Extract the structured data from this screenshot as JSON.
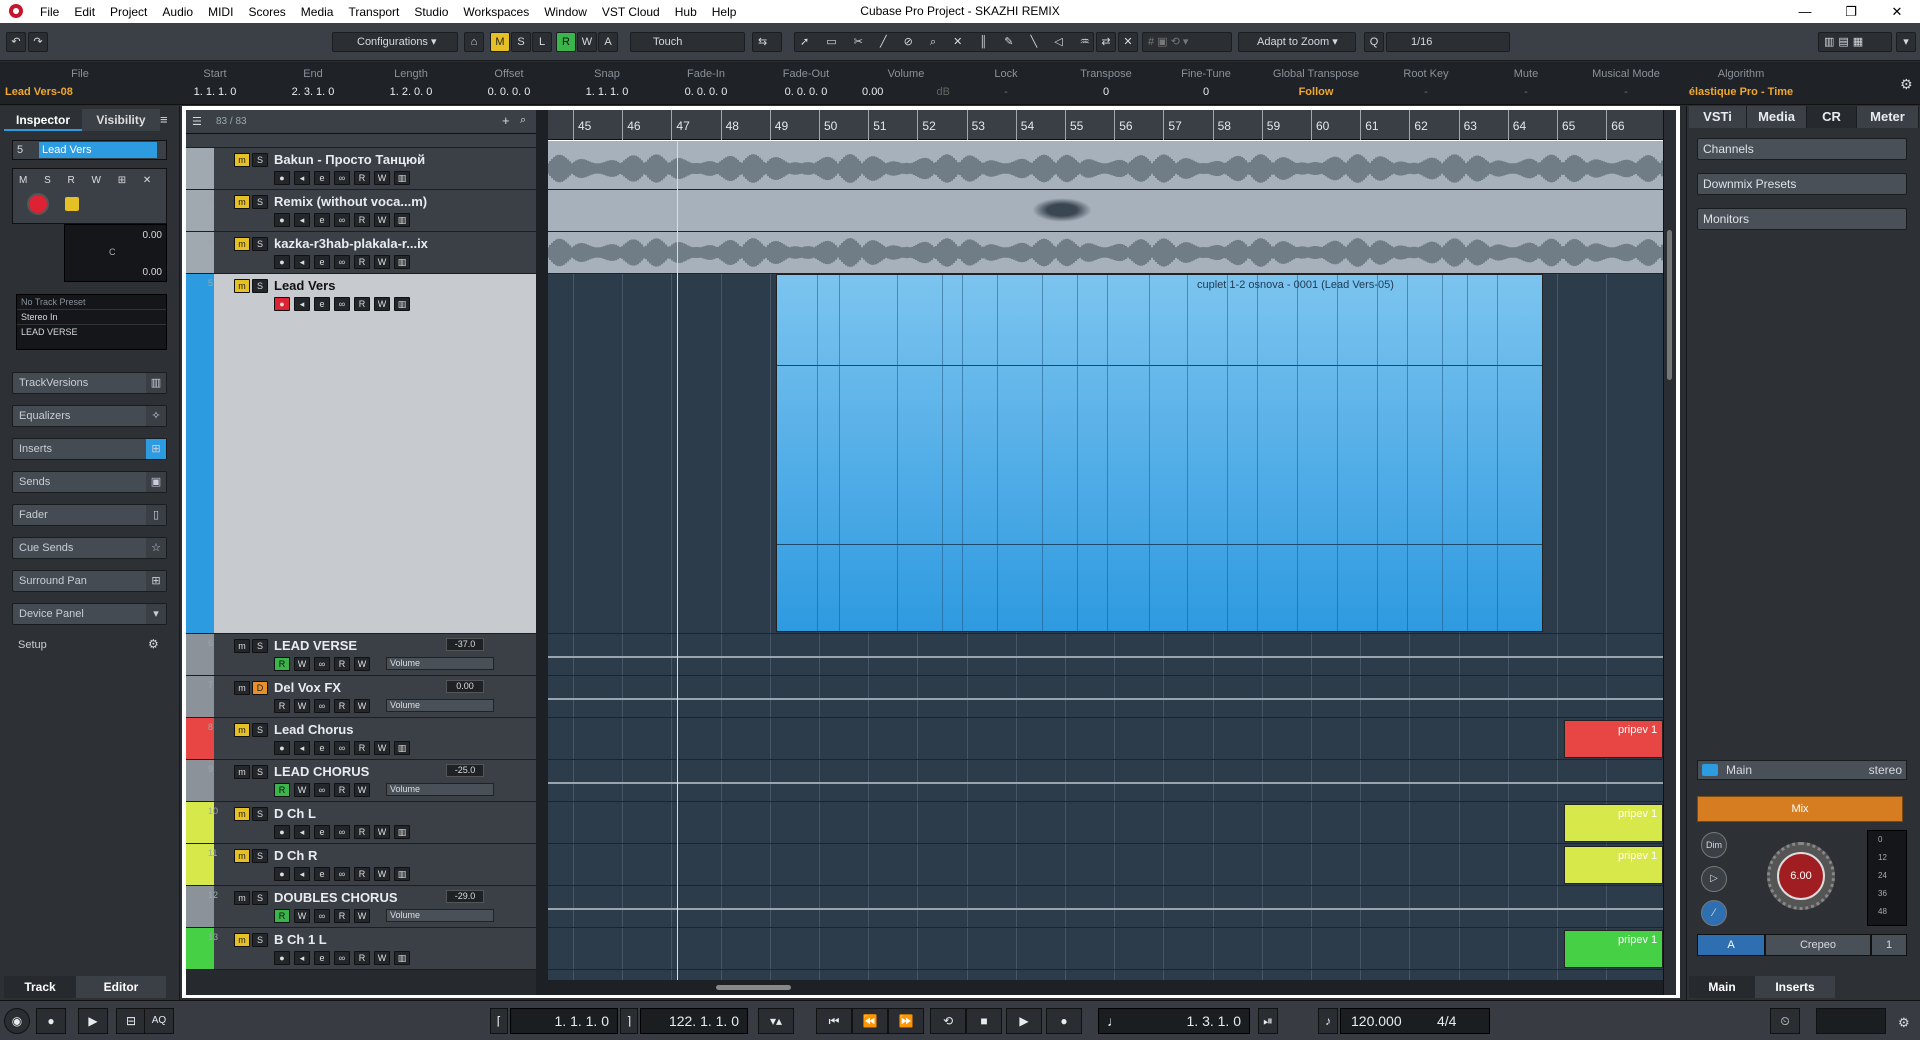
{
  "titlebar": {
    "title": "Cubase Pro Project - SKAZHI REMIX",
    "menu": [
      "File",
      "Edit",
      "Project",
      "Audio",
      "MIDI",
      "Scores",
      "Media",
      "Transport",
      "Studio",
      "Workspaces",
      "Window",
      "VST Cloud",
      "Hub",
      "Help"
    ],
    "minimize": "—",
    "restore": "❐",
    "close": "✕"
  },
  "toolbar": {
    "configurations": "Configurations",
    "m": "M",
    "s": "S",
    "l": "L",
    "r": "R",
    "w": "W",
    "a": "A",
    "automation_mode": "Touch",
    "zoom_mode": "Adapt to Zoom",
    "quantize": "1/16"
  },
  "infoline": {
    "headers": [
      "File",
      "Start",
      "End",
      "Length",
      "Offset",
      "Snap",
      "Fade-In",
      "Fade-Out",
      "Volume",
      "Lock",
      "Transpose",
      "Fine-Tune",
      "Global Transpose",
      "Root Key",
      "Mute",
      "Musical Mode",
      "Algorithm"
    ],
    "values": [
      "Lead Vers-08",
      "1. 1. 1.   0",
      "2. 3. 1.   0",
      "1. 2. 0.   0",
      "0. 0. 0.   0",
      "1. 1. 1.   0",
      "0. 0. 0.   0",
      "0. 0. 0.   0",
      "0.00",
      "-",
      "0",
      "0",
      "Follow",
      "-",
      "-",
      "-",
      "élastique Pro - Time"
    ],
    "volume_unit": "dB"
  },
  "inspector": {
    "tab_inspector": "Inspector",
    "tab_visibility": "Visibility",
    "track_name": "Lead Vers",
    "track_num": "5",
    "fader_value": "0.00",
    "pan_value": "0.00",
    "pan_center": "C",
    "preset": "No Track Preset",
    "input": "Stereo In",
    "output": "LEAD VERSE",
    "sections": [
      "TrackVersions",
      "Equalizers",
      "Inserts",
      "Sends",
      "Fader",
      "Cue Sends",
      "Surround Pan",
      "Device Panel"
    ],
    "setup": "Setup",
    "bottom_track": "Track",
    "bottom_editor": "Editor"
  },
  "tracklist": {
    "count": "83 / 83",
    "tracks": [
      {
        "num": "2",
        "name": "Bakun - Просто Танцюй",
        "color": "#a0a8b0",
        "type": "audio"
      },
      {
        "num": "3",
        "name": "Remix (without voca...m)",
        "color": "#a0a8b0",
        "type": "audio"
      },
      {
        "num": "4",
        "name": "kazka-r3hab-plakala-r...ix",
        "color": "#a0a8b0",
        "type": "audio"
      },
      {
        "num": "5",
        "name": "Lead Vers",
        "color": "#2d9be0",
        "type": "audio_sel"
      },
      {
        "num": "6",
        "name": "LEAD VERSE",
        "color": "#8b9299",
        "type": "group",
        "vol": "-37.0",
        "param": "Volume"
      },
      {
        "num": "7",
        "name": "Del Vox FX",
        "color": "#8b9299",
        "type": "fx",
        "vol": "0.00",
        "param": "Volume"
      },
      {
        "num": "8",
        "name": "Lead Chorus",
        "color": "#e84545",
        "type": "audio"
      },
      {
        "num": "9",
        "name": "LEAD CHORUS",
        "color": "#8b9299",
        "type": "group",
        "vol": "-25.0",
        "param": "Volume"
      },
      {
        "num": "10",
        "name": "D Ch L",
        "color": "#d7e84a",
        "type": "audio"
      },
      {
        "num": "11",
        "name": "D Ch R",
        "color": "#d7e84a",
        "type": "audio"
      },
      {
        "num": "12",
        "name": "DOUBLES CHORUS",
        "color": "#8b9299",
        "type": "group",
        "vol": "-29.0",
        "param": "Volume"
      },
      {
        "num": "13",
        "name": "B Ch 1 L",
        "color": "#45d045",
        "type": "audio"
      }
    ]
  },
  "ruler": {
    "bars": [
      "45",
      "46",
      "47",
      "48",
      "49",
      "50",
      "51",
      "52",
      "53",
      "54",
      "55",
      "56",
      "57",
      "58",
      "59",
      "60",
      "61",
      "62",
      "63",
      "64",
      "65",
      "66"
    ]
  },
  "events": {
    "main_clip": "cuplet 1-2 osnova - 0001 (Lead Vers-05)",
    "chorus_clip": "pripev 1",
    "dch_l_clip": "pripev 1",
    "dch_r_clip": "pripev 1",
    "bch_clip": "pripev 1"
  },
  "rightzone": {
    "tabs": [
      "VSTi",
      "Media",
      "CR",
      "Meter"
    ],
    "sections": [
      "Channels",
      "Downmix Presets",
      "Monitors"
    ],
    "main": "Main",
    "main_format": "stereo",
    "mix": "Mix",
    "dim": "Dim",
    "knob": "6.00",
    "a": "A",
    "crepeo": "Crepeo",
    "one": "1",
    "bottom_main": "Main",
    "bottom_inserts": "Inserts",
    "meter_ticks": [
      "0",
      "12",
      "24",
      "36",
      "48"
    ]
  },
  "transport": {
    "left_locator": "1. 1. 1.    0",
    "right_locator": "122. 1. 1.    0",
    "position": "1. 3. 1.    0",
    "tempo": "120.000",
    "signature": "4/4",
    "aq": "AQ"
  },
  "colors": {
    "accent": "#2d9be0",
    "chorus": "#e84545",
    "doubles": "#d7e84a",
    "bch": "#45d045",
    "infoline_highlight": "#f0a830"
  }
}
